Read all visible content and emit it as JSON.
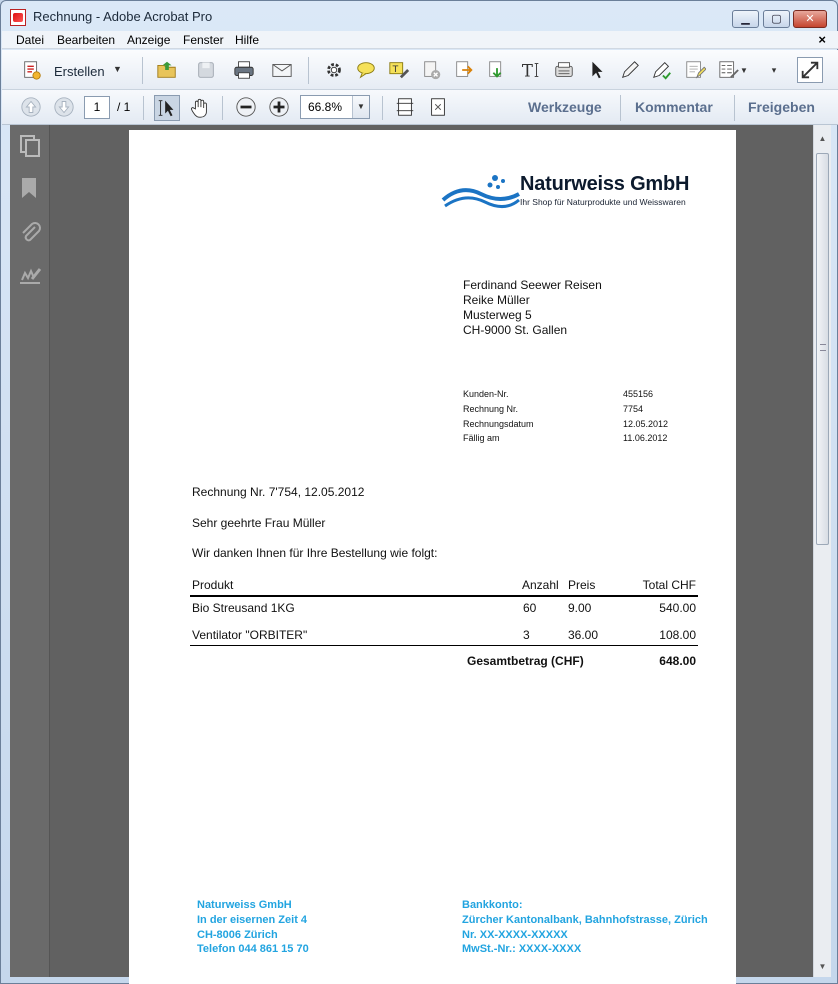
{
  "window": {
    "title": "Rechnung - Adobe Acrobat Pro"
  },
  "menubar": {
    "items": [
      "Datei",
      "Bearbeiten",
      "Anzeige",
      "Fenster",
      "Hilfe"
    ],
    "close": "×"
  },
  "toolbar": {
    "create_label": "Erstellen"
  },
  "nav": {
    "page_current": "1",
    "page_total": "/ 1",
    "zoom": "66.8%"
  },
  "panels": {
    "tools": "Werkzeuge",
    "comment": "Kommentar",
    "share": "Freigeben"
  },
  "document": {
    "company": {
      "name": "Naturweiss GmbH",
      "tagline": "Ihr Shop für Naturprodukte und Weisswaren"
    },
    "recipient": [
      "Ferdinand Seewer Reisen",
      "Reike Müller",
      "Musterweg 5",
      "CH-9000 St. Gallen"
    ],
    "meta": [
      {
        "label": "Kunden-Nr.",
        "value": "455156"
      },
      {
        "label": "Rechnung Nr.",
        "value": "7754"
      },
      {
        "label": "Rechnungsdatum",
        "value": "12.05.2012"
      },
      {
        "label": "Fällig am",
        "value": "11.06.2012"
      }
    ],
    "subject": "Rechnung Nr. 7'754, 12.05.2012",
    "salutation": "Sehr geehrte Frau Müller",
    "intro": "Wir danken Ihnen für Ihre Bestellung wie folgt:",
    "table": {
      "headers": {
        "product": "Produkt",
        "qty": "Anzahl",
        "price": "Preis",
        "total": "Total CHF"
      },
      "rows": [
        {
          "product": "Bio Streusand 1KG",
          "qty": "60",
          "price": "9.00",
          "total": "540.00"
        },
        {
          "product": "Ventilator \"ORBITER\"",
          "qty": "3",
          "price": "36.00",
          "total": "108.00"
        }
      ],
      "grand_total_label": "Gesamtbetrag (CHF)",
      "grand_total": "648.00"
    },
    "footer_left": [
      "Naturweiss GmbH",
      "In der eisernen Zeit 4",
      "CH-8006 Zürich",
      "Telefon 044 861 15 70"
    ],
    "footer_right": [
      "Bankkonto:",
      "Zürcher Kantonalbank, Bahnhofstrasse, Zürich",
      "Nr. XX-XXXX-XXXXX",
      "MwSt.-Nr.: XXXX-XXXX"
    ]
  },
  "colors": {
    "accent_footer": "#22a4e0",
    "panel_link": "#5b6f8e"
  }
}
